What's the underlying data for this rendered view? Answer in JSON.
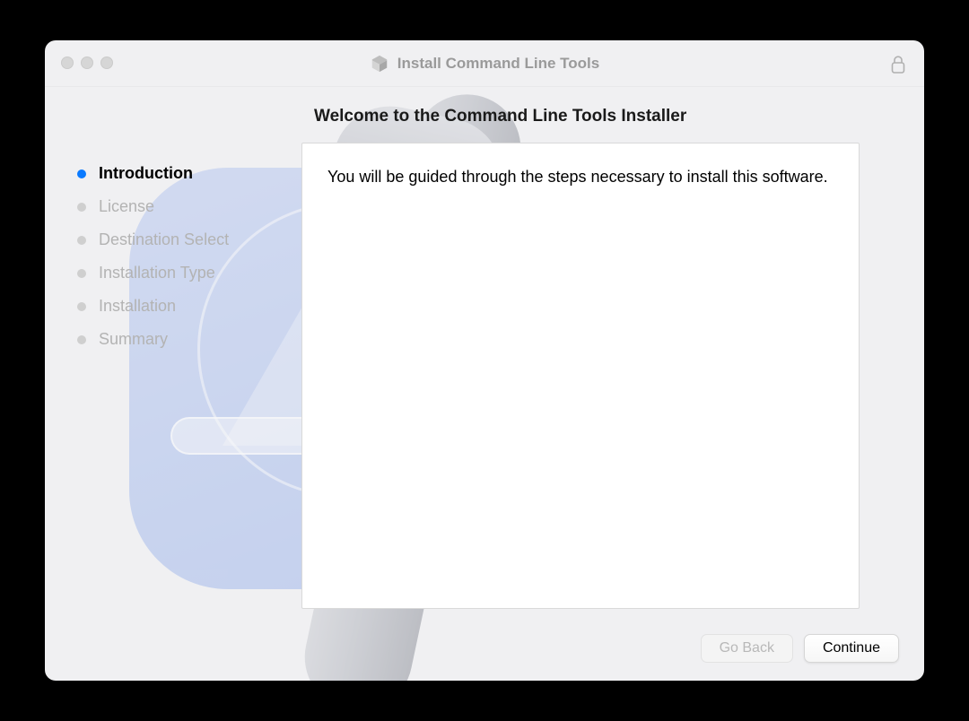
{
  "window": {
    "title": "Install Command Line Tools"
  },
  "heading": "Welcome to the Command Line Tools Installer",
  "sidebar": {
    "steps": [
      {
        "label": "Introduction",
        "active": true
      },
      {
        "label": "License",
        "active": false
      },
      {
        "label": "Destination Select",
        "active": false
      },
      {
        "label": "Installation Type",
        "active": false
      },
      {
        "label": "Installation",
        "active": false
      },
      {
        "label": "Summary",
        "active": false
      }
    ]
  },
  "main": {
    "text": "You will be guided through the steps necessary to install this software."
  },
  "footer": {
    "go_back_label": "Go Back",
    "continue_label": "Continue"
  }
}
